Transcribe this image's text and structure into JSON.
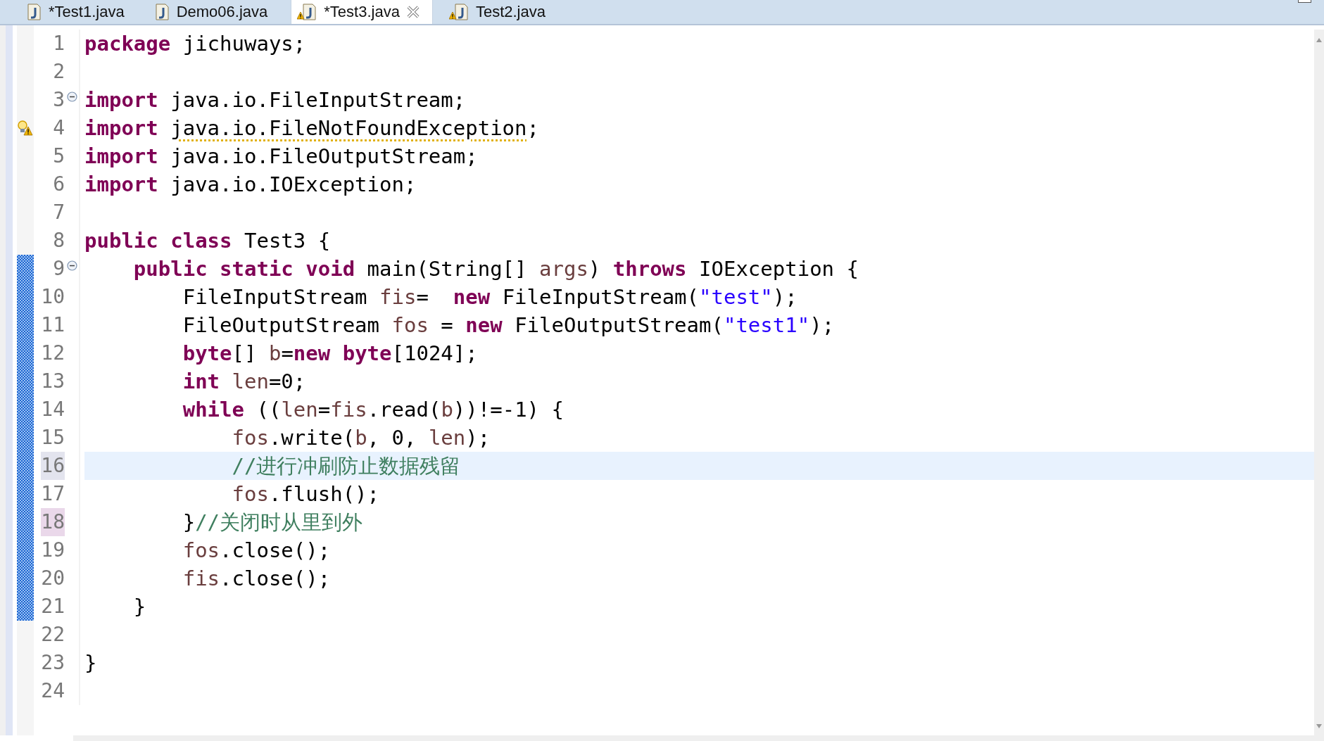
{
  "tabs": [
    {
      "label": "*Test1.java",
      "selected": false,
      "warning": false
    },
    {
      "label": "Demo06.java",
      "selected": false,
      "warning": false
    },
    {
      "label": "*Test3.java",
      "selected": true,
      "warning": true
    },
    {
      "label": "Test2.java",
      "selected": false,
      "warning": true
    }
  ],
  "editor": {
    "lines": [
      {
        "number": "1",
        "selected": false,
        "matched": false,
        "changed": false,
        "folding": false,
        "warning": false,
        "tokens": [
          {
            "kind": "keyword",
            "text": "package"
          },
          {
            "kind": "text",
            "text": " jichuways;"
          }
        ]
      },
      {
        "number": "2",
        "selected": false,
        "matched": false,
        "changed": false,
        "folding": false,
        "warning": false
      },
      {
        "number": "3",
        "selected": false,
        "matched": false,
        "changed": false,
        "folding": true,
        "warning": false,
        "tokens": [
          {
            "kind": "keyword",
            "text": "import"
          },
          {
            "kind": "text",
            "text": " java.io.FileInputStream;"
          }
        ]
      },
      {
        "number": "4",
        "selected": false,
        "matched": false,
        "changed": false,
        "folding": false,
        "warning": true,
        "tokens": [
          {
            "kind": "keyword",
            "text": "import "
          },
          {
            "kind": "warning",
            "text": "java.io.FileNotFoundException"
          },
          {
            "kind": "text",
            "text": ";"
          }
        ]
      },
      {
        "number": "5",
        "selected": false,
        "matched": false,
        "changed": false,
        "folding": false,
        "warning": false,
        "tokens": [
          {
            "kind": "keyword",
            "text": "import"
          },
          {
            "kind": "text",
            "text": " java.io.FileOutputStream;"
          }
        ]
      },
      {
        "number": "6",
        "selected": false,
        "matched": false,
        "changed": false,
        "folding": false,
        "warning": false,
        "tokens": [
          {
            "kind": "keyword",
            "text": "import"
          },
          {
            "kind": "text",
            "text": " java.io.IOException;"
          }
        ]
      },
      {
        "number": "7",
        "selected": false,
        "matched": false,
        "changed": false,
        "folding": false,
        "warning": false
      },
      {
        "number": "8",
        "selected": false,
        "matched": false,
        "changed": false,
        "folding": false,
        "warning": false,
        "tokens": [
          {
            "kind": "keyword",
            "text": "public class"
          },
          {
            "kind": "text",
            "text": " Test3 {"
          }
        ]
      },
      {
        "number": "9",
        "selected": false,
        "matched": false,
        "changed": true,
        "folding": true,
        "warning": false,
        "tokens": [
          {
            "kind": "keyword",
            "text": "    public static void"
          },
          {
            "kind": "text",
            "text": " main(String[] "
          },
          {
            "kind": "variable",
            "text": "args"
          },
          {
            "kind": "text",
            "text": ") "
          },
          {
            "kind": "keyword",
            "text": "throws"
          },
          {
            "kind": "text",
            "text": " IOException {"
          }
        ]
      },
      {
        "number": "10",
        "selected": false,
        "matched": false,
        "changed": true,
        "folding": false,
        "warning": false,
        "tokens": [
          {
            "kind": "text",
            "text": "        FileInputStream "
          },
          {
            "kind": "variable",
            "text": "fis"
          },
          {
            "kind": "text",
            "text": "=  "
          },
          {
            "kind": "keyword",
            "text": "new"
          },
          {
            "kind": "text",
            "text": " FileInputStream("
          },
          {
            "kind": "string",
            "text": "\"test\""
          },
          {
            "kind": "text",
            "text": ");"
          }
        ]
      },
      {
        "number": "11",
        "selected": false,
        "matched": false,
        "changed": true,
        "folding": false,
        "warning": false,
        "tokens": [
          {
            "kind": "text",
            "text": "        FileOutputStream "
          },
          {
            "kind": "variable",
            "text": "fos"
          },
          {
            "kind": "text",
            "text": " = "
          },
          {
            "kind": "keyword",
            "text": "new"
          },
          {
            "kind": "text",
            "text": " FileOutputStream("
          },
          {
            "kind": "string",
            "text": "\"test1\""
          },
          {
            "kind": "text",
            "text": ");"
          }
        ]
      },
      {
        "number": "12",
        "selected": false,
        "matched": false,
        "changed": true,
        "folding": false,
        "warning": false,
        "tokens": [
          {
            "kind": "keyword",
            "text": "        byte"
          },
          {
            "kind": "text",
            "text": "[] "
          },
          {
            "kind": "variable",
            "text": "b"
          },
          {
            "kind": "text",
            "text": "="
          },
          {
            "kind": "keyword",
            "text": "new byte"
          },
          {
            "kind": "text",
            "text": "[1024];"
          }
        ]
      },
      {
        "number": "13",
        "selected": false,
        "matched": false,
        "changed": true,
        "folding": false,
        "warning": false,
        "tokens": [
          {
            "kind": "keyword",
            "text": "        int "
          },
          {
            "kind": "variable",
            "text": "len"
          },
          {
            "kind": "text",
            "text": "=0;"
          }
        ]
      },
      {
        "number": "14",
        "selected": false,
        "matched": false,
        "changed": true,
        "folding": false,
        "warning": false,
        "tokens": [
          {
            "kind": "keyword",
            "text": "        while"
          },
          {
            "kind": "text",
            "text": " (("
          },
          {
            "kind": "variable",
            "text": "len"
          },
          {
            "kind": "text",
            "text": "="
          },
          {
            "kind": "variable",
            "text": "fis"
          },
          {
            "kind": "text",
            "text": ".read("
          },
          {
            "kind": "variable",
            "text": "b"
          },
          {
            "kind": "text",
            "text": "))!=-1) {"
          }
        ]
      },
      {
        "number": "15",
        "selected": false,
        "matched": false,
        "changed": true,
        "folding": false,
        "warning": false,
        "tokens": [
          {
            "kind": "variable",
            "text": "            fos"
          },
          {
            "kind": "text",
            "text": ".write("
          },
          {
            "kind": "variable",
            "text": "b"
          },
          {
            "kind": "text",
            "text": ", 0, "
          },
          {
            "kind": "variable",
            "text": "len"
          },
          {
            "kind": "text",
            "text": ");"
          }
        ]
      },
      {
        "number": "16",
        "selected": true,
        "matched": false,
        "changed": true,
        "folding": false,
        "warning": false,
        "tokens": [
          {
            "kind": "comment",
            "text": "            //进行冲刷防止数据残留"
          }
        ]
      },
      {
        "number": "17",
        "selected": false,
        "matched": false,
        "changed": true,
        "folding": false,
        "warning": false,
        "tokens": [
          {
            "kind": "variable",
            "text": "            fos"
          },
          {
            "kind": "text",
            "text": ".flush();"
          }
        ]
      },
      {
        "number": "18",
        "selected": false,
        "matched": true,
        "changed": true,
        "folding": false,
        "warning": false,
        "tokens": [
          {
            "kind": "text",
            "text": "        }"
          },
          {
            "kind": "comment",
            "text": "//关闭时从里到外"
          }
        ]
      },
      {
        "number": "19",
        "selected": false,
        "matched": false,
        "changed": true,
        "folding": false,
        "warning": false,
        "tokens": [
          {
            "kind": "variable",
            "text": "        fos"
          },
          {
            "kind": "text",
            "text": ".close();"
          }
        ]
      },
      {
        "number": "20",
        "selected": false,
        "matched": false,
        "changed": true,
        "folding": false,
        "warning": false,
        "tokens": [
          {
            "kind": "variable",
            "text": "        fis"
          },
          {
            "kind": "text",
            "text": ".close();"
          }
        ]
      },
      {
        "number": "21",
        "selected": false,
        "matched": false,
        "changed": true,
        "folding": false,
        "warning": false,
        "tokens": [
          {
            "kind": "text",
            "text": "    }"
          }
        ]
      },
      {
        "number": "22",
        "selected": false,
        "matched": false,
        "changed": false,
        "folding": false,
        "warning": false
      },
      {
        "number": "23",
        "selected": false,
        "matched": false,
        "changed": false,
        "folding": false,
        "warning": false,
        "tokens": [
          {
            "kind": "text",
            "text": "}"
          }
        ]
      },
      {
        "number": "24",
        "selected": false,
        "matched": false,
        "changed": false,
        "folding": false,
        "warning": false
      }
    ]
  }
}
